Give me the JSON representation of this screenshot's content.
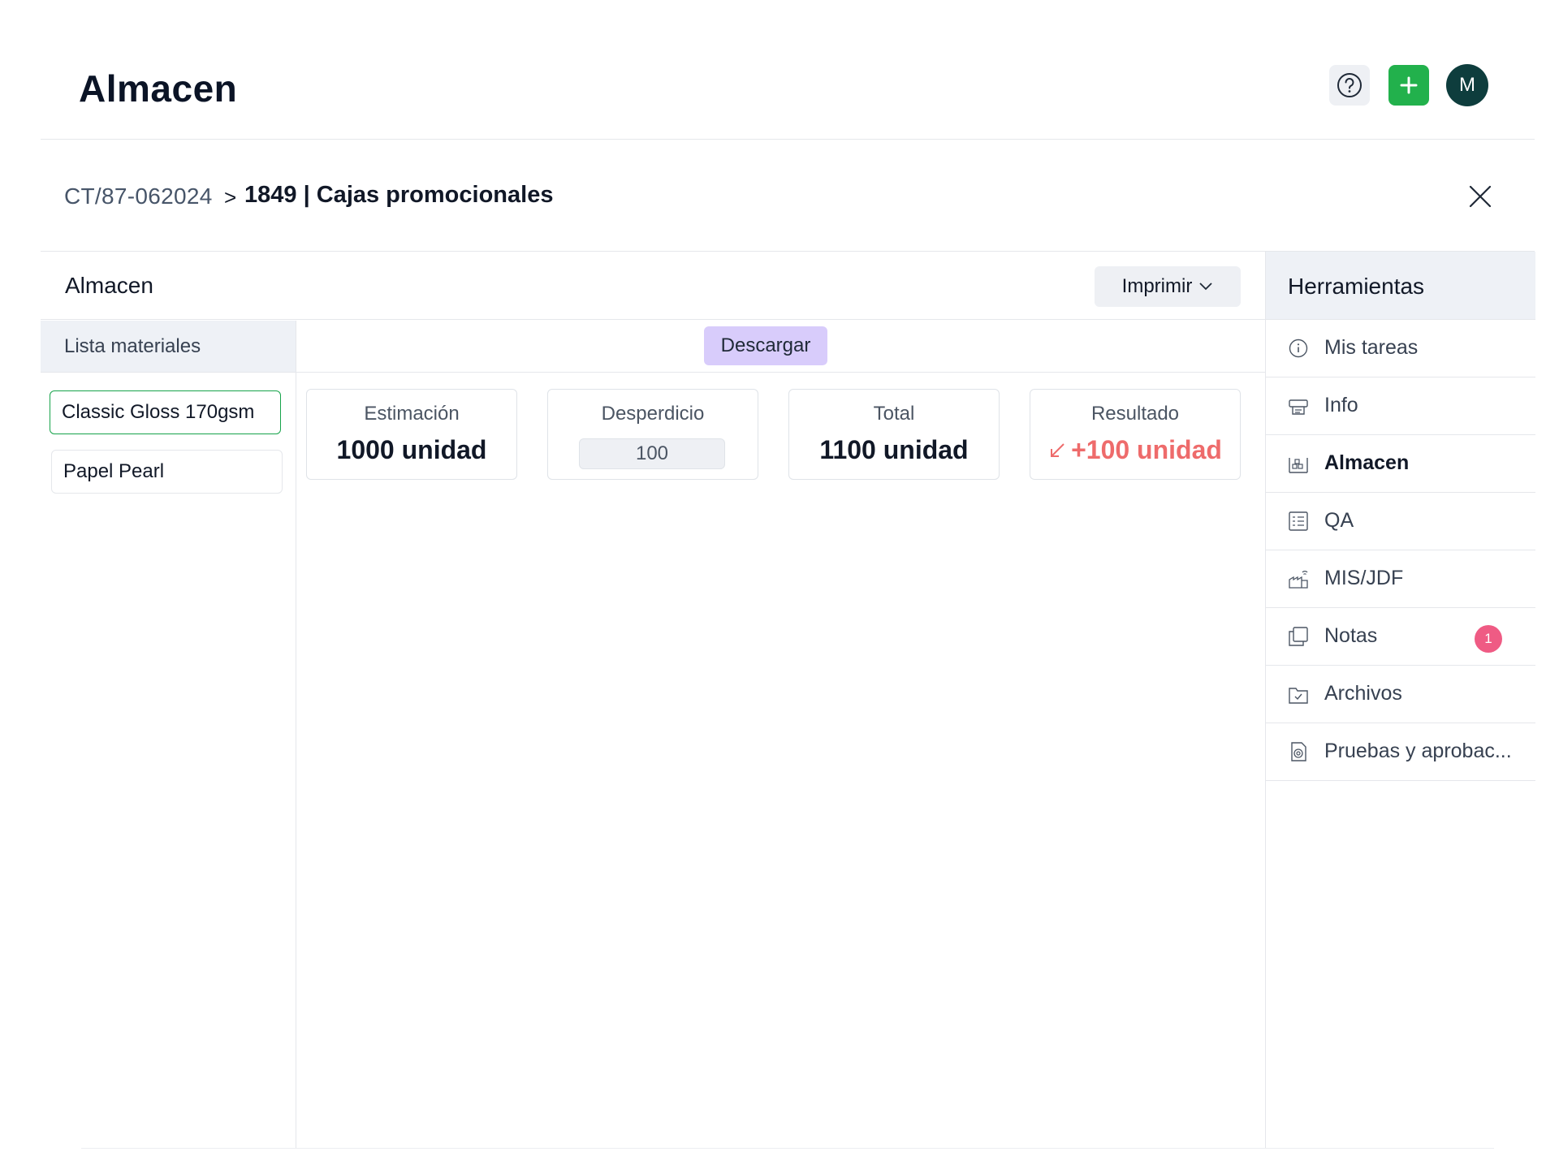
{
  "app": {
    "title": "Almacen",
    "avatar_initial": "M"
  },
  "breadcrumb": {
    "code": "CT/87-062024",
    "separator": ">",
    "title": "1849 | Cajas promocionales"
  },
  "panel": {
    "title": "Almacen",
    "print_label": "Imprimir"
  },
  "materials": {
    "header": "Lista materiales",
    "items": [
      "Classic Gloss 170gsm",
      "Papel Pearl"
    ]
  },
  "download_label": "Descargar",
  "cards": {
    "estimacion": {
      "label": "Estimación",
      "value": "1000 unidad"
    },
    "desperdicio": {
      "label": "Desperdicio",
      "value": "100"
    },
    "total": {
      "label": "Total",
      "value": "1100 unidad"
    },
    "resultado": {
      "label": "Resultado",
      "value": "+100 unidad"
    }
  },
  "tools": {
    "header": "Herramientas",
    "items": [
      {
        "label": "Mis tareas",
        "icon": "info-circle-icon"
      },
      {
        "label": "Info",
        "icon": "printer-info-icon"
      },
      {
        "label": "Almacen",
        "icon": "warehouse-icon"
      },
      {
        "label": "QA",
        "icon": "checklist-icon"
      },
      {
        "label": "MIS/JDF",
        "icon": "factory-icon"
      },
      {
        "label": "Notas",
        "icon": "notes-icon",
        "badge": "1"
      },
      {
        "label": "Archivos",
        "icon": "folder-check-icon"
      },
      {
        "label": "Pruebas y aprobac...",
        "icon": "proof-document-icon"
      }
    ]
  },
  "colors": {
    "accent_green": "#22b14c",
    "avatar": "#0e3d3d",
    "download": "#d8ccfb",
    "negative": "#ee6b6b",
    "badge": "#ef5b84"
  }
}
